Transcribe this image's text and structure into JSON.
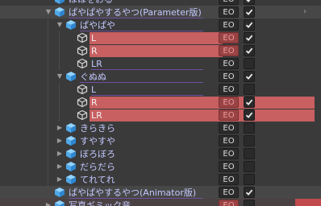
{
  "buttons": {
    "eo_label": "EO"
  },
  "colors": {
    "highlight": "#c85f61",
    "label_purple": "#c4c8ff",
    "background": "#3a3a3a"
  },
  "rows": [
    {
      "label": "ほほをおる",
      "kind": "cube",
      "foldout": "none",
      "checked": true
    },
    {
      "label": "ぱやぱやするやつ(Parameter版)",
      "kind": "cube",
      "foldout": "down",
      "checked": true
    },
    {
      "label": "ぱやぱや",
      "kind": "cube",
      "foldout": "down",
      "checked": true
    },
    {
      "label": "L",
      "kind": "cube-outline",
      "foldout": "none",
      "checked": true,
      "highlight": true
    },
    {
      "label": "R",
      "kind": "cube-outline",
      "foldout": "none",
      "checked": true,
      "highlight": true
    },
    {
      "label": "LR",
      "kind": "cube-outline",
      "foldout": "none",
      "checked": false
    },
    {
      "label": "ぐぬぬ",
      "kind": "cube",
      "foldout": "down",
      "checked": true
    },
    {
      "label": "L",
      "kind": "cube-outline",
      "foldout": "none",
      "checked": false
    },
    {
      "label": "R",
      "kind": "cube-outline",
      "foldout": "none",
      "checked": true,
      "highlight": true
    },
    {
      "label": "LR",
      "kind": "cube-outline",
      "foldout": "none",
      "checked": true,
      "highlight": true
    },
    {
      "label": "きらきら",
      "kind": "cube",
      "foldout": "right",
      "checked": false
    },
    {
      "label": "すやすや",
      "kind": "cube",
      "foldout": "right",
      "checked": false
    },
    {
      "label": "ぼろぼろ",
      "kind": "cube",
      "foldout": "right",
      "checked": false
    },
    {
      "label": "だらだら",
      "kind": "cube",
      "foldout": "right",
      "checked": false
    },
    {
      "label": "てれてれ",
      "kind": "cube",
      "foldout": "right",
      "checked": false
    },
    {
      "label": "ぱやぱやするやつ(Animator版)",
      "kind": "cube",
      "foldout": "none",
      "checked": true
    },
    {
      "label": "写真ギミック音",
      "kind": "cube",
      "foldout": "right",
      "checked": false
    }
  ]
}
